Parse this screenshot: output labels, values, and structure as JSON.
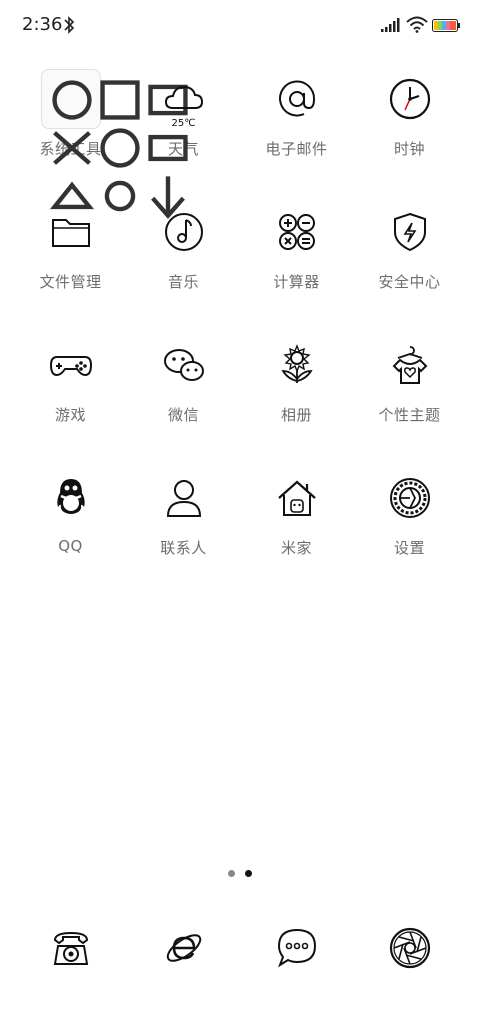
{
  "status": {
    "time": "2:36"
  },
  "apps": [
    {
      "label": "系统工具",
      "icon": "folder-icon"
    },
    {
      "label": "天气",
      "icon": "cloud-icon",
      "temp": "25℃"
    },
    {
      "label": "电子邮件",
      "icon": "at-sign-icon"
    },
    {
      "label": "时钟",
      "icon": "clock-icon"
    },
    {
      "label": "文件管理",
      "icon": "file-folder-icon"
    },
    {
      "label": "音乐",
      "icon": "music-note-icon"
    },
    {
      "label": "计算器",
      "icon": "calculator-icon"
    },
    {
      "label": "安全中心",
      "icon": "shield-icon"
    },
    {
      "label": "游戏",
      "icon": "gamepad-icon"
    },
    {
      "label": "微信",
      "icon": "wechat-icon"
    },
    {
      "label": "相册",
      "icon": "flower-icon"
    },
    {
      "label": "个性主题",
      "icon": "shirt-icon"
    },
    {
      "label": "QQ",
      "icon": "penguin-icon"
    },
    {
      "label": "联系人",
      "icon": "person-icon"
    },
    {
      "label": "米家",
      "icon": "house-icon"
    },
    {
      "label": "设置",
      "icon": "gear-icon"
    }
  ],
  "page_indicator": {
    "count": 2,
    "active": 2
  },
  "dock": [
    {
      "icon": "telephone-icon"
    },
    {
      "icon": "browser-icon"
    },
    {
      "icon": "messages-icon"
    },
    {
      "icon": "camera-icon"
    }
  ]
}
